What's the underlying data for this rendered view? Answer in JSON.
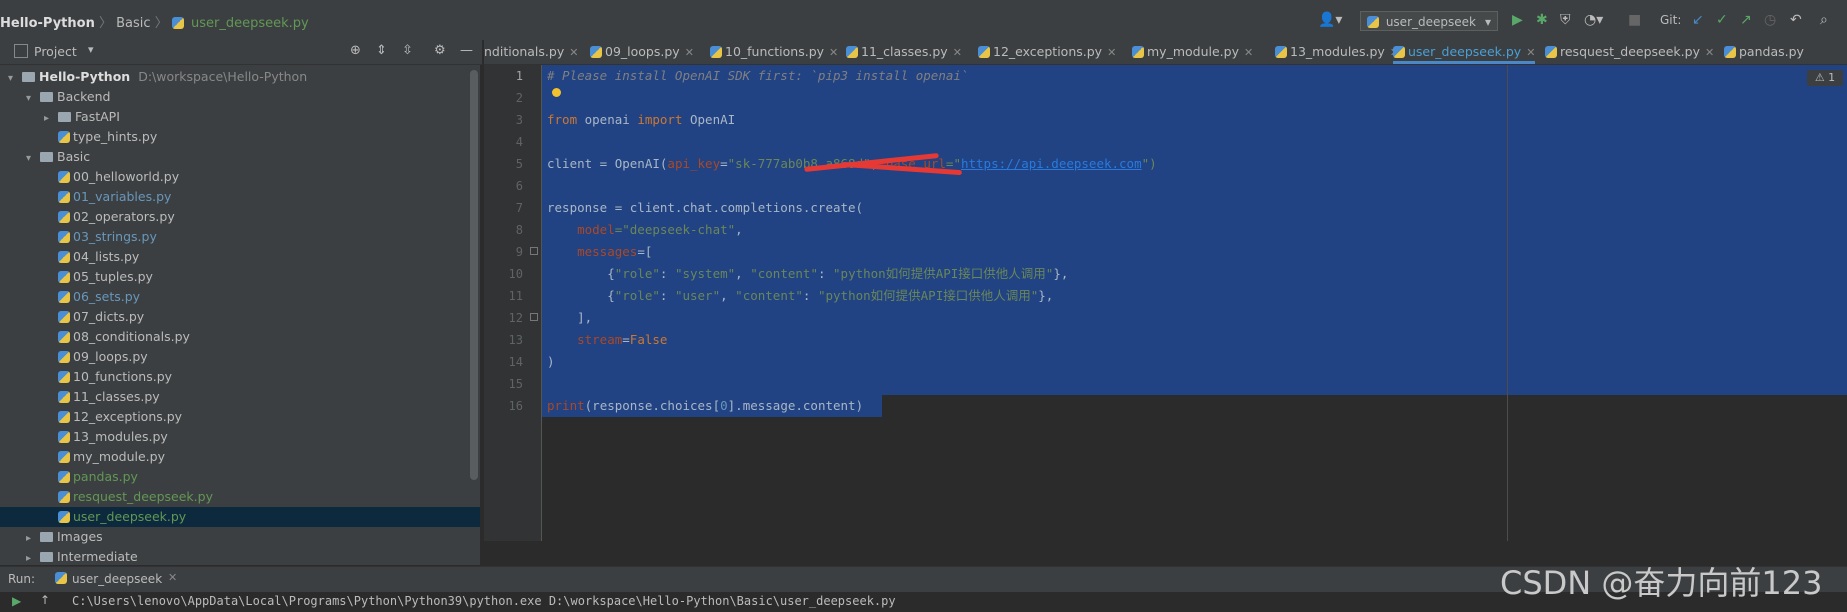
{
  "breadcrumb": {
    "project": "Hello-Python",
    "folder": "Basic",
    "file": "user_deepseek.py"
  },
  "run_config": "user_deepseek",
  "git_label": "Git:",
  "project_pane": {
    "label": "Project"
  },
  "tabs": [
    {
      "label": "nditionals.py",
      "active": false
    },
    {
      "label": "09_loops.py",
      "active": false
    },
    {
      "label": "10_functions.py",
      "active": false
    },
    {
      "label": "11_classes.py",
      "active": false
    },
    {
      "label": "12_exceptions.py",
      "active": false
    },
    {
      "label": "my_module.py",
      "active": false
    },
    {
      "label": "13_modules.py",
      "active": false
    },
    {
      "label": "user_deepseek.py",
      "active": true
    },
    {
      "label": "resquest_deepseek.py",
      "active": false
    },
    {
      "label": "pandas.py",
      "active": false
    }
  ],
  "tree": [
    {
      "label": "Hello-Python",
      "path": "D:\\workspace\\Hello-Python",
      "type": "root",
      "depth": 0,
      "expanded": true
    },
    {
      "label": "Backend",
      "type": "folder",
      "depth": 1,
      "expanded": true
    },
    {
      "label": "FastAPI",
      "type": "folder",
      "depth": 2,
      "expanded": false
    },
    {
      "label": "type_hints.py",
      "type": "file",
      "depth": 2,
      "color": "#bbbbbb"
    },
    {
      "label": "Basic",
      "type": "folder",
      "depth": 1,
      "expanded": true
    },
    {
      "label": "00_helloworld.py",
      "type": "file",
      "depth": 2,
      "color": "#bbbbbb"
    },
    {
      "label": "01_variables.py",
      "type": "file",
      "depth": 2,
      "color": "#6897bb"
    },
    {
      "label": "02_operators.py",
      "type": "file",
      "depth": 2,
      "color": "#bbbbbb"
    },
    {
      "label": "03_strings.py",
      "type": "file",
      "depth": 2,
      "color": "#6897bb"
    },
    {
      "label": "04_lists.py",
      "type": "file",
      "depth": 2,
      "color": "#bbbbbb"
    },
    {
      "label": "05_tuples.py",
      "type": "file",
      "depth": 2,
      "color": "#bbbbbb"
    },
    {
      "label": "06_sets.py",
      "type": "file",
      "depth": 2,
      "color": "#6897bb"
    },
    {
      "label": "07_dicts.py",
      "type": "file",
      "depth": 2,
      "color": "#bbbbbb"
    },
    {
      "label": "08_conditionals.py",
      "type": "file",
      "depth": 2,
      "color": "#bbbbbb"
    },
    {
      "label": "09_loops.py",
      "type": "file",
      "depth": 2,
      "color": "#bbbbbb"
    },
    {
      "label": "10_functions.py",
      "type": "file",
      "depth": 2,
      "color": "#bbbbbb"
    },
    {
      "label": "11_classes.py",
      "type": "file",
      "depth": 2,
      "color": "#bbbbbb"
    },
    {
      "label": "12_exceptions.py",
      "type": "file",
      "depth": 2,
      "color": "#bbbbbb"
    },
    {
      "label": "13_modules.py",
      "type": "file",
      "depth": 2,
      "color": "#bbbbbb"
    },
    {
      "label": "my_module.py",
      "type": "file",
      "depth": 2,
      "color": "#bbbbbb"
    },
    {
      "label": "pandas.py",
      "type": "file",
      "depth": 2,
      "color": "#629755"
    },
    {
      "label": "resquest_deepseek.py",
      "type": "file",
      "depth": 2,
      "color": "#629755"
    },
    {
      "label": "user_deepseek.py",
      "type": "file",
      "depth": 2,
      "color": "#629755",
      "selected": true
    },
    {
      "label": "Images",
      "type": "folder",
      "depth": 1,
      "expanded": false
    },
    {
      "label": "Intermediate",
      "type": "folder",
      "depth": 1,
      "expanded": false
    }
  ],
  "editor": {
    "line_numbers": [
      "1",
      "2",
      "3",
      "4",
      "5",
      "6",
      "7",
      "8",
      "9",
      "10",
      "11",
      "12",
      "13",
      "14",
      "15",
      "16"
    ],
    "warning_count": "1",
    "lines": {
      "l1": "# Please install OpenAI SDK first: `pip3 install openai`",
      "l3_kw1": "from",
      "l3_mod": " openai ",
      "l3_kw2": "import",
      "l3_cls": " OpenAI",
      "l5_a": "client = OpenAI(",
      "l5_p1": "api_key",
      "l5_eq": "=",
      "l5_key": "\"sk-777ab0b8…a868d\"",
      "l5_comma": ", ",
      "l5_p2": "base_url",
      "l5_eq2": "=\"",
      "l5_url": "https://api.deepseek.com",
      "l5_end": "\")",
      "l7": "response = client.chat.completions.create(",
      "l8_p": "    model",
      "l8_v": "=\"deepseek-chat\"",
      "l8_c": ",",
      "l9_p": "    messages",
      "l9_v": "=[",
      "l10_a": "        {",
      "l10_k1": "\"role\"",
      "l10_s1": ": ",
      "l10_v1": "\"system\"",
      "l10_s2": ", ",
      "l10_k2": "\"content\"",
      "l10_s3": ": ",
      "l10_v2": "\"python如何提供API接口供他人调用\"",
      "l10_e": "},",
      "l11_a": "        {",
      "l11_k1": "\"role\"",
      "l11_s1": ": ",
      "l11_v1": "\"user\"",
      "l11_s2": ", ",
      "l11_k2": "\"content\"",
      "l11_s3": ": ",
      "l11_v2": "\"python如何提供API接口供他人调用\"",
      "l11_e": "},",
      "l12": "    ],",
      "l13_p": "    stream",
      "l13_eq": "=",
      "l13_v": "False",
      "l14": ")",
      "l16_f": "print",
      "l16_a": "(response.choices[",
      "l16_n": "0",
      "l16_b": "].message.content)"
    }
  },
  "run_panel": {
    "label": "Run:",
    "config": "user_deepseek"
  },
  "console": {
    "command": "C:\\Users\\lenovo\\AppData\\Local\\Programs\\Python\\Python39\\python.exe D:\\workspace\\Hello-Python\\Basic\\user_deepseek.py"
  },
  "watermark": "CSDN @奋力向前123"
}
